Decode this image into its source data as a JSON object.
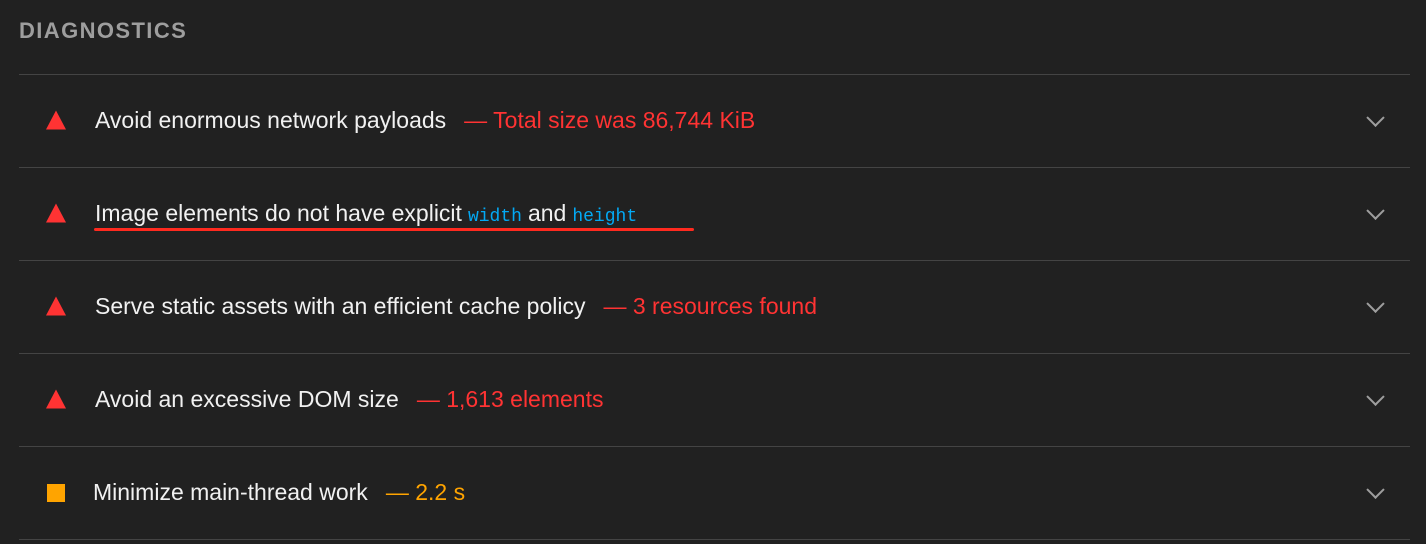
{
  "section": {
    "title": "DIAGNOSTICS"
  },
  "audits": [
    {
      "title": "Avoid enormous network payloads",
      "display_value": "— Total size was 86,744 KiB",
      "status": "fail",
      "icon": "fail-triangle-icon"
    },
    {
      "title_prefix": "Image elements do not have explicit",
      "code1": "width",
      "title_mid": "and",
      "code2": "height",
      "status": "fail",
      "icon": "fail-triangle-icon",
      "annotation": "red-underline"
    },
    {
      "title": "Serve static assets with an efficient cache policy",
      "display_value": "— 3 resources found",
      "status": "fail",
      "icon": "fail-triangle-icon"
    },
    {
      "title": "Avoid an excessive DOM size",
      "display_value": "— 1,613 elements",
      "status": "fail",
      "icon": "fail-triangle-icon"
    },
    {
      "title": "Minimize main-thread work",
      "display_value": "— 2.2 s",
      "status": "average",
      "icon": "warn-square-icon"
    }
  ],
  "colors": {
    "background": "#212121",
    "fail": "#ff3333",
    "average": "#ffa400",
    "code": "#03a9f4",
    "heading": "#9e9e9e"
  }
}
